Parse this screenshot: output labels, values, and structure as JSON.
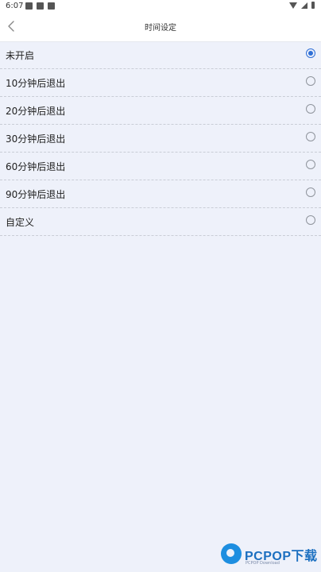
{
  "status_bar": {
    "time": "6:07",
    "left_icons": [
      "image-icon",
      "app-icon",
      "notification-icon"
    ],
    "right_icons": [
      "wifi-icon",
      "signal-icon",
      "battery-icon"
    ]
  },
  "header": {
    "back_icon": "chevron-left-icon",
    "title": "时间设定"
  },
  "options": [
    {
      "label": "未开启",
      "selected": true
    },
    {
      "label": "10分钟后退出",
      "selected": false
    },
    {
      "label": "20分钟后退出",
      "selected": false
    },
    {
      "label": "30分钟后退出",
      "selected": false
    },
    {
      "label": "60分钟后退出",
      "selected": false
    },
    {
      "label": "90分钟后退出",
      "selected": false
    },
    {
      "label": "自定义",
      "selected": false
    }
  ],
  "watermark": {
    "text": "PCPOP下载",
    "subtext": "PCPOP Download"
  },
  "colors": {
    "accent": "#2f6fd6",
    "background": "#eef1fa",
    "header_bg": "#ffffff",
    "watermark_blue": "#1b6fc0"
  }
}
